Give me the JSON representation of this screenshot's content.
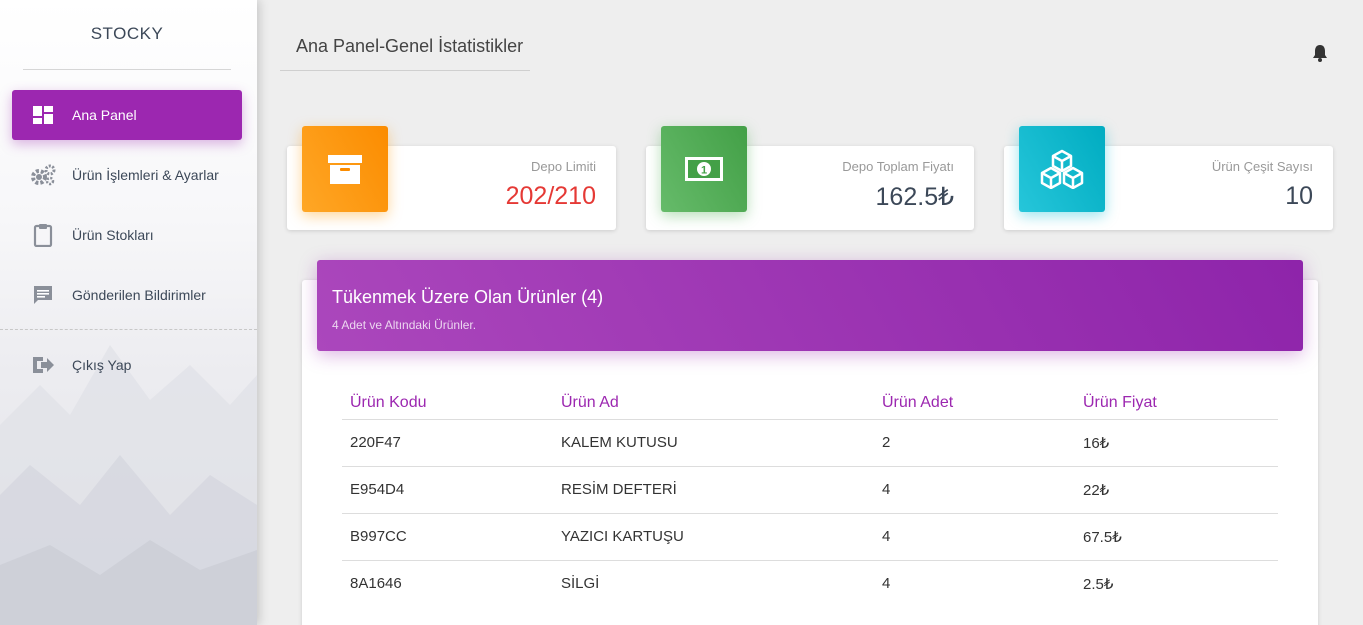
{
  "sidebar": {
    "brand": "STOCKY",
    "items": [
      {
        "label": "Ana Panel",
        "icon": "dashboard-icon",
        "active": true
      },
      {
        "label": "Ürün İşlemleri & Ayarlar",
        "icon": "gears-icon",
        "active": false
      },
      {
        "label": "Ürün Stokları",
        "icon": "clipboard-icon",
        "active": false
      },
      {
        "label": "Gönderilen Bildirimler",
        "icon": "message-icon",
        "active": false
      },
      {
        "label": "Çıkış Yap",
        "icon": "logout-icon",
        "active": false
      }
    ]
  },
  "header": {
    "title": "Ana Panel-Genel İstatistikler",
    "notification_icon": "bell-icon"
  },
  "stats": [
    {
      "label": "Depo Limiti",
      "value": "202/210",
      "icon": "archive-icon",
      "color": "#fb8c00",
      "value_color": "#e53935"
    },
    {
      "label": "Depo Toplam Fiyatı",
      "value": "162.5₺",
      "icon": "money-icon",
      "color": "#43a047",
      "value_color": "#3c4858"
    },
    {
      "label": "Ürün Çeşit Sayısı",
      "value": "10",
      "icon": "cubes-icon",
      "color": "#00acc1",
      "value_color": "#3c4858"
    }
  ],
  "low_stock": {
    "title": "Tükenmek Üzere Olan Ürünler (4)",
    "subtitle": "4 Adet ve Altındaki Ürünler.",
    "columns": [
      "Ürün Kodu",
      "Ürün Ad",
      "Ürün Adet",
      "Ürün Fiyat"
    ],
    "rows": [
      [
        "220F47",
        "KALEM KUTUSU",
        "2",
        "16₺"
      ],
      [
        "E954D4",
        "RESİM DEFTERİ",
        "4",
        "22₺"
      ],
      [
        "B997CC",
        "YAZICI KARTUŞU",
        "4",
        "67.5₺"
      ],
      [
        "8A1646",
        "SİLGİ",
        "4",
        "2.5₺"
      ]
    ]
  },
  "colors": {
    "accent": "#9c27b0",
    "sidebar_icon": "#8a8f99"
  }
}
